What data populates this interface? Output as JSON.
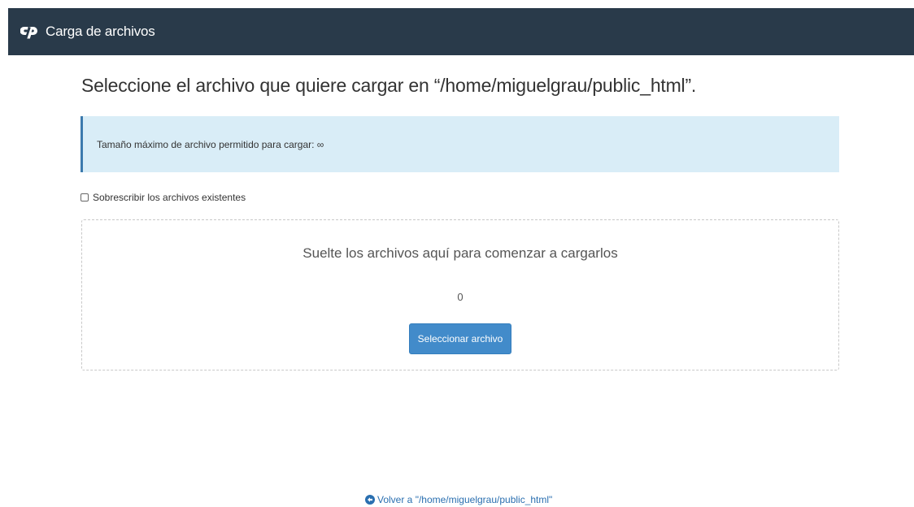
{
  "header": {
    "logo_icon": "cpanel-logo-icon",
    "title": "Carga de archivos"
  },
  "main": {
    "heading": "Seleccione el archivo que quiere cargar en “/home/miguelgrau/public_html”.",
    "info": {
      "text": "Tamaño máximo de archivo permitido para cargar: ∞"
    },
    "overwrite": {
      "label": "Sobrescribir los archivos existentes",
      "checked": false
    },
    "dropzone": {
      "text": "Suelte los archivos aquí para comenzar a cargarlos",
      "count": "0",
      "button_label": "Seleccionar archivo"
    }
  },
  "footer": {
    "back_icon": "arrow-circle-left-icon",
    "back_label": "Volver a \"/home/miguelgrau/public_html\""
  },
  "colors": {
    "header_bg": "#293a4a",
    "info_bg": "#d9edf7",
    "info_border": "#3c7aad",
    "button_bg": "#428bca",
    "link": "#2a6fb0"
  }
}
